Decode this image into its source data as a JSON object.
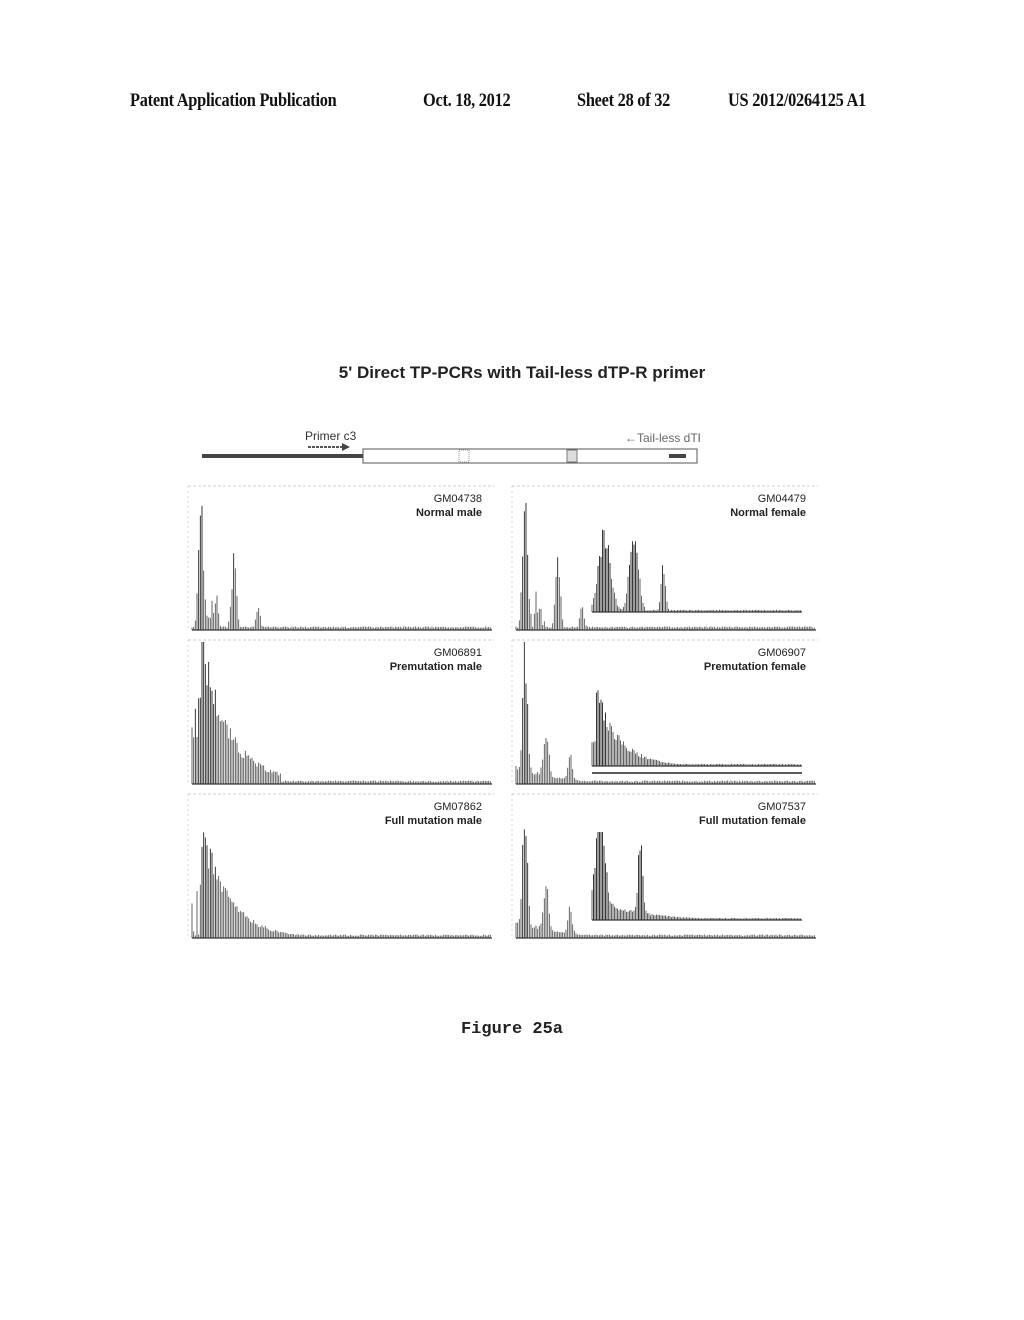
{
  "header": {
    "publication_label": "Patent Application Publication",
    "date": "Oct. 18, 2012",
    "sheet": "Sheet 28 of 32",
    "number": "US 2012/0264125 A1"
  },
  "figure": {
    "title": "5' Direct TP-PCRs with Tail-less dTP-R primer",
    "caption": "Figure 25a",
    "diagram": {
      "forward_primer_label": "Primer c3",
      "reverse_primer_label": "←Tail-less dTP-R"
    },
    "panels": [
      {
        "sample_id": "GM04738",
        "description": "Normal male",
        "profile": "normal",
        "inset": false
      },
      {
        "sample_id": "GM04479",
        "description": "Normal female",
        "profile": "normal",
        "inset": true,
        "inset_profile": "two-peak"
      },
      {
        "sample_id": "GM06891",
        "description": "Premutation male",
        "profile": "decay",
        "inset": false
      },
      {
        "sample_id": "GM06907",
        "description": "Premutation female",
        "profile": "normal-decay",
        "inset": true,
        "inset_profile": "single-decay"
      },
      {
        "sample_id": "GM07862",
        "description": "Full mutation male",
        "profile": "decay-long",
        "inset": false
      },
      {
        "sample_id": "GM07537",
        "description": "Full mutation female",
        "profile": "normal-decay",
        "inset": true,
        "inset_profile": "two-peak-decay"
      }
    ]
  }
}
